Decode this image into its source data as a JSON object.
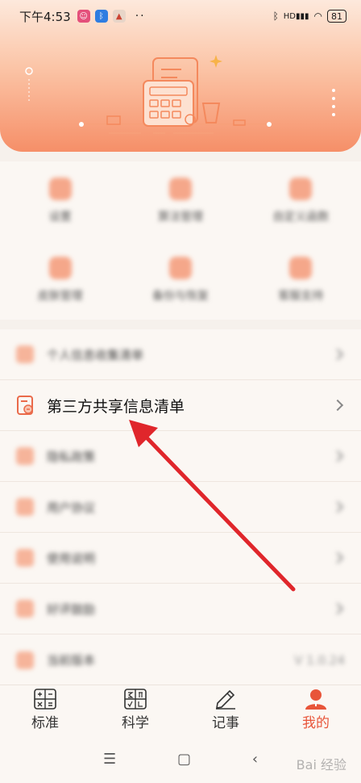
{
  "status_bar": {
    "time": "下午4:53",
    "signal_text": "HD",
    "battery": "81"
  },
  "grid": {
    "items": [
      {
        "label": "设置"
      },
      {
        "label": "算法管理"
      },
      {
        "label": "自定义函数"
      },
      {
        "label": "皮肤管理"
      },
      {
        "label": "备份与恢复"
      },
      {
        "label": "客服支持"
      }
    ]
  },
  "list": {
    "items": [
      {
        "label": "个人信息收集清单",
        "right": ""
      },
      {
        "label": "第三方共享信息清单",
        "right": ""
      },
      {
        "label": "隐私政策",
        "right": ""
      },
      {
        "label": "用户协议",
        "right": ""
      },
      {
        "label": "使用说明",
        "right": ""
      },
      {
        "label": "好评鼓励",
        "right": ""
      },
      {
        "label": "当前版本",
        "right": "V 1.0.24"
      }
    ]
  },
  "tabs": [
    {
      "label": "标准"
    },
    {
      "label": "科学"
    },
    {
      "label": "记事"
    },
    {
      "label": "我的"
    }
  ],
  "watermark": "Bai 经验",
  "colors": {
    "accent": "#e8553a",
    "arrow": "#e0262b",
    "banner_top": "#fde9dc",
    "banner_bottom": "#f68f68"
  }
}
